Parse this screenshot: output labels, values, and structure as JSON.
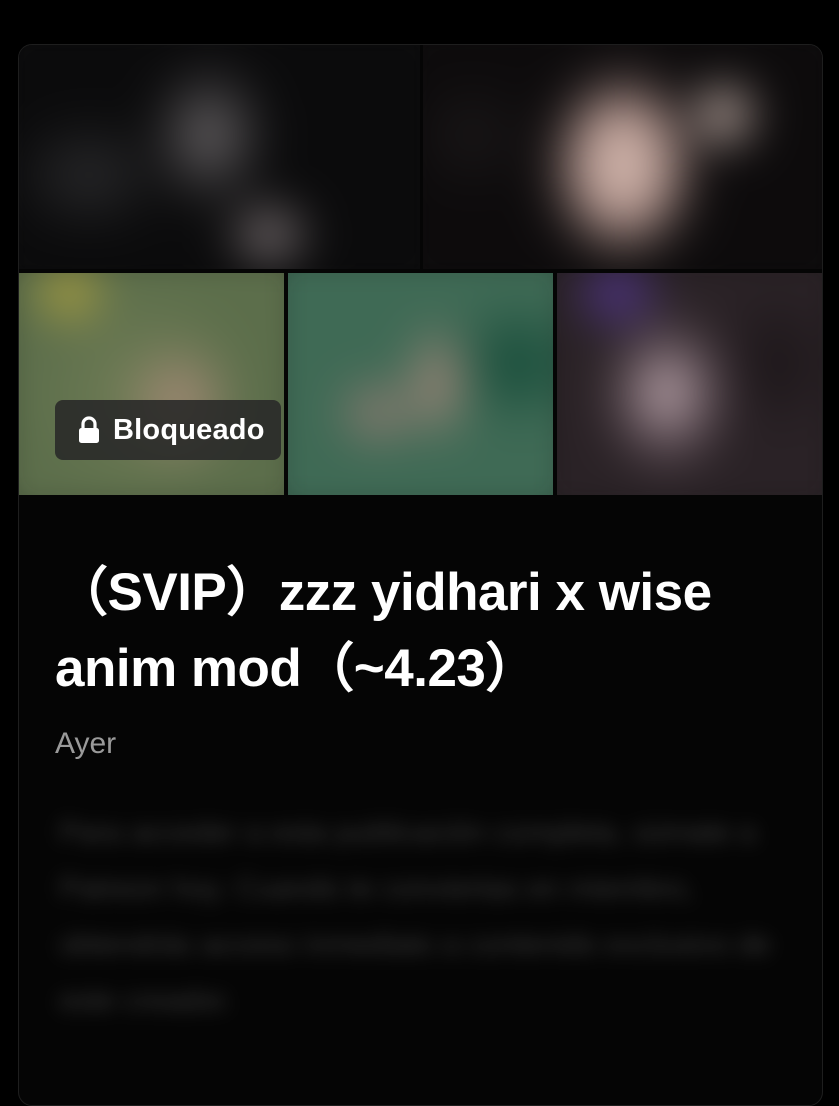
{
  "post": {
    "locked_label": "Bloqueado",
    "title": "（SVIP）zzz yidhari x wise anim mod（~4.23）",
    "date": "Ayer",
    "preview_text": "Para acceder a esta publicación completa, súmate a Patreon hoy. Cuando te conviertas en miembro, obtendrás acceso inmediato a contenido exclusivo de este creador."
  },
  "icons": {
    "lock": "lock-icon"
  },
  "colors": {
    "background": "#000000",
    "card": "#050505",
    "title": "#ffffff",
    "date": "#9a9a9a",
    "badge": "#282828"
  }
}
